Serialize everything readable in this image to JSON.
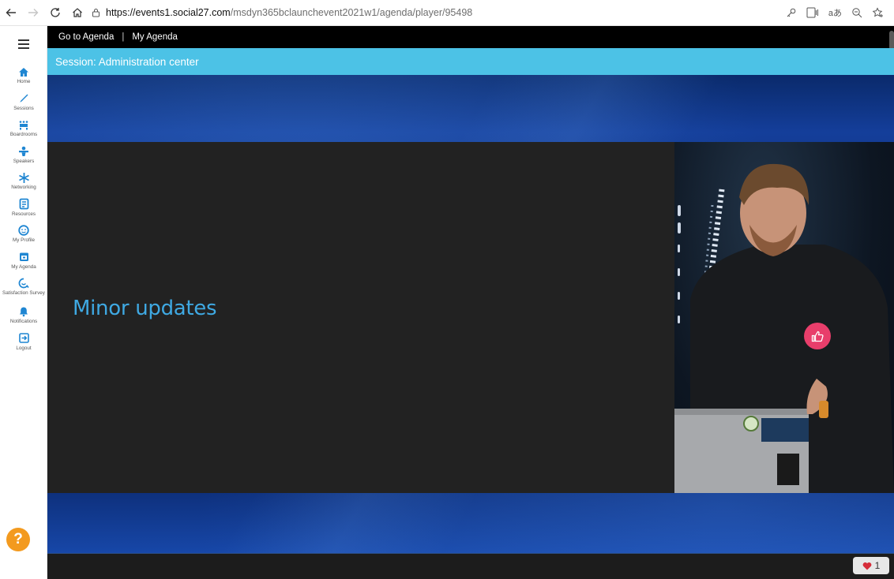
{
  "browser": {
    "url_host": "https://events1.social27.com",
    "url_path": "/msdyn365bclaunchevent2021w1/agenda/player/95498"
  },
  "top_nav": {
    "go_to_agenda": "Go to Agenda",
    "separator": "|",
    "my_agenda": "My Agenda"
  },
  "session": {
    "title": "Session: Administration center"
  },
  "sidebar": {
    "items": [
      {
        "label": "Home",
        "icon": "home-icon"
      },
      {
        "label": "Sessions",
        "icon": "pencil-icon"
      },
      {
        "label": "Boardrooms",
        "icon": "boardroom-icon"
      },
      {
        "label": "Speakers",
        "icon": "speaker-icon"
      },
      {
        "label": "Networking",
        "icon": "networking-icon"
      },
      {
        "label": "Resources",
        "icon": "resources-icon"
      },
      {
        "label": "My Profile",
        "icon": "profile-icon"
      },
      {
        "label": "My Agenda",
        "icon": "calendar-icon"
      },
      {
        "label": "Satisfaction Survey",
        "icon": "survey-icon"
      },
      {
        "label": "Notifications",
        "icon": "bell-icon"
      },
      {
        "label": "Logout",
        "icon": "logout-icon"
      }
    ],
    "help_label": "?"
  },
  "video": {
    "slide_title": "Minor updates"
  },
  "reactions": {
    "heart_count": "1"
  },
  "colors": {
    "session_bar": "#4cc2e6",
    "accent_blue": "#1f86d2",
    "like_button": "#e83e6b",
    "help_button": "#f39a1f"
  }
}
